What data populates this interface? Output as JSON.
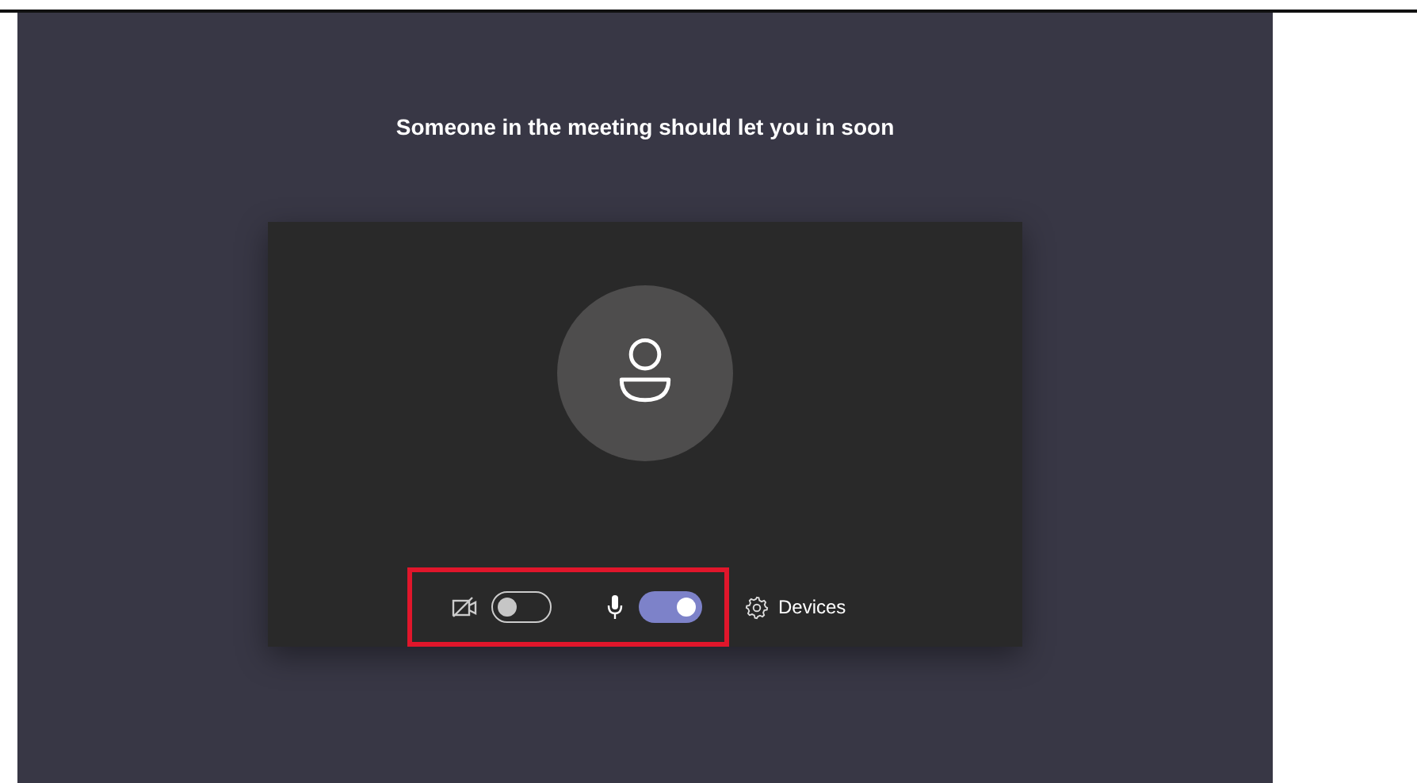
{
  "lobby": {
    "message": "Someone in the meeting should let you in soon"
  },
  "controls": {
    "highlighted": true,
    "camera": {
      "on": false
    },
    "microphone": {
      "on": true
    },
    "devices": {
      "label": "Devices"
    }
  }
}
